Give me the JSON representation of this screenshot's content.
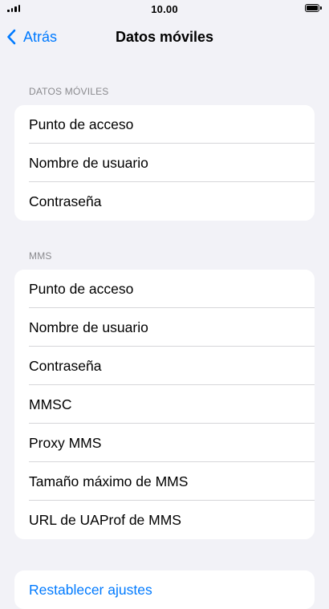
{
  "status_bar": {
    "time": "10.00"
  },
  "nav": {
    "back_label": "Atrás",
    "title": "Datos móviles"
  },
  "sections": {
    "mobile_data": {
      "header": "DATOS MÓVILES",
      "rows": [
        "Punto de acceso",
        "Nombre de usuario",
        "Contraseña"
      ]
    },
    "mms": {
      "header": "MMS",
      "rows": [
        "Punto de acceso",
        "Nombre de usuario",
        "Contraseña",
        "MMSC",
        "Proxy MMS",
        "Tamaño máximo de MMS",
        "URL de UAProf de MMS"
      ]
    },
    "reset": {
      "label": "Restablecer ajustes"
    }
  },
  "colors": {
    "accent": "#007aff",
    "background": "#f2f2f7",
    "secondary_text": "#8a8a8e"
  }
}
